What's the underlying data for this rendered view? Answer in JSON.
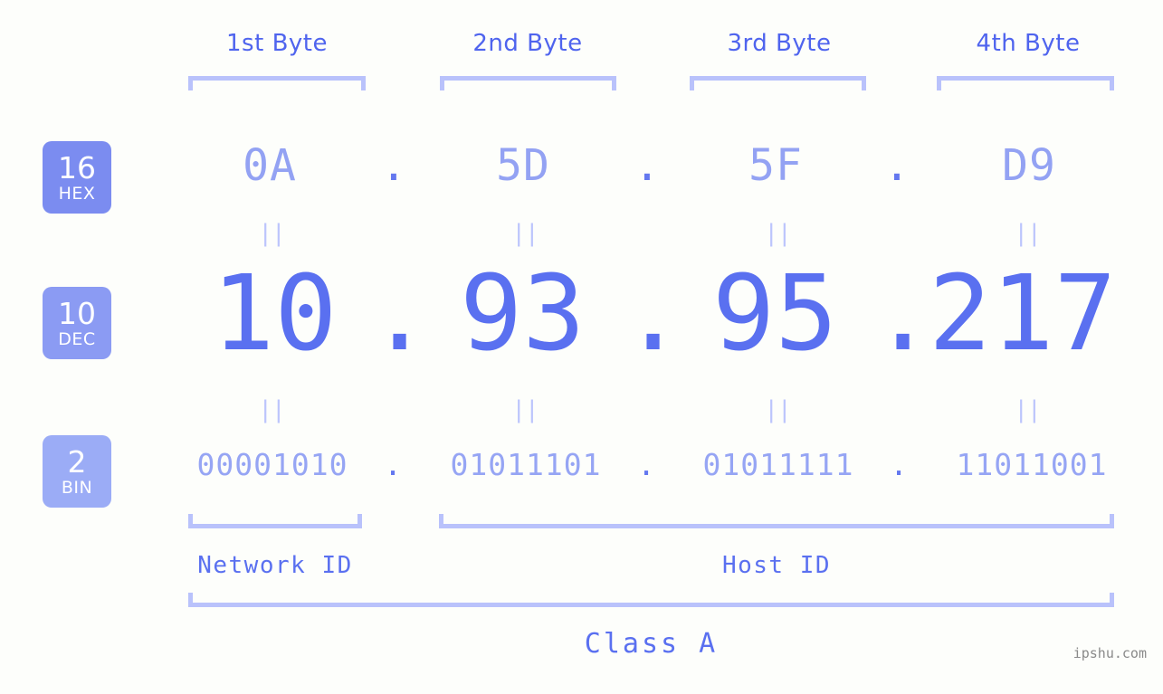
{
  "meta": {
    "watermark": "ipshu.com",
    "background_color": "#fdfefb",
    "accent_color": "#5a70f0",
    "light_accent_color": "#b9c2fb"
  },
  "header": {
    "byte_labels": [
      {
        "label": "1st Byte"
      },
      {
        "label": "2nd Byte"
      },
      {
        "label": "3rd Byte"
      },
      {
        "label": "4th Byte"
      }
    ]
  },
  "bases": [
    {
      "num": "16",
      "name": "HEX",
      "color": "#7b8cf0"
    },
    {
      "num": "10",
      "name": "DEC",
      "color": "#8b9bf3"
    },
    {
      "num": "2",
      "name": "BIN",
      "color": "#9bacf6"
    }
  ],
  "rows": {
    "hex": {
      "values": [
        "0A",
        "5D",
        "5F",
        "D9"
      ],
      "separators": [
        ".",
        ".",
        "."
      ]
    },
    "dec": {
      "values": [
        "10",
        "93",
        "95",
        "217"
      ],
      "separators": [
        ".",
        ".",
        "."
      ]
    },
    "bin": {
      "values": [
        "00001010",
        "01011101",
        "01011111",
        "11011001"
      ],
      "separators": [
        ".",
        ".",
        "."
      ]
    }
  },
  "equality_marks": {
    "hex_to_dec": [
      "||",
      "||",
      "||",
      "||"
    ],
    "dec_to_bin": [
      "||",
      "||",
      "||",
      "||"
    ]
  },
  "footer": {
    "network_id_label": "Network ID",
    "host_id_label": "Host ID",
    "class_label": "Class A"
  }
}
